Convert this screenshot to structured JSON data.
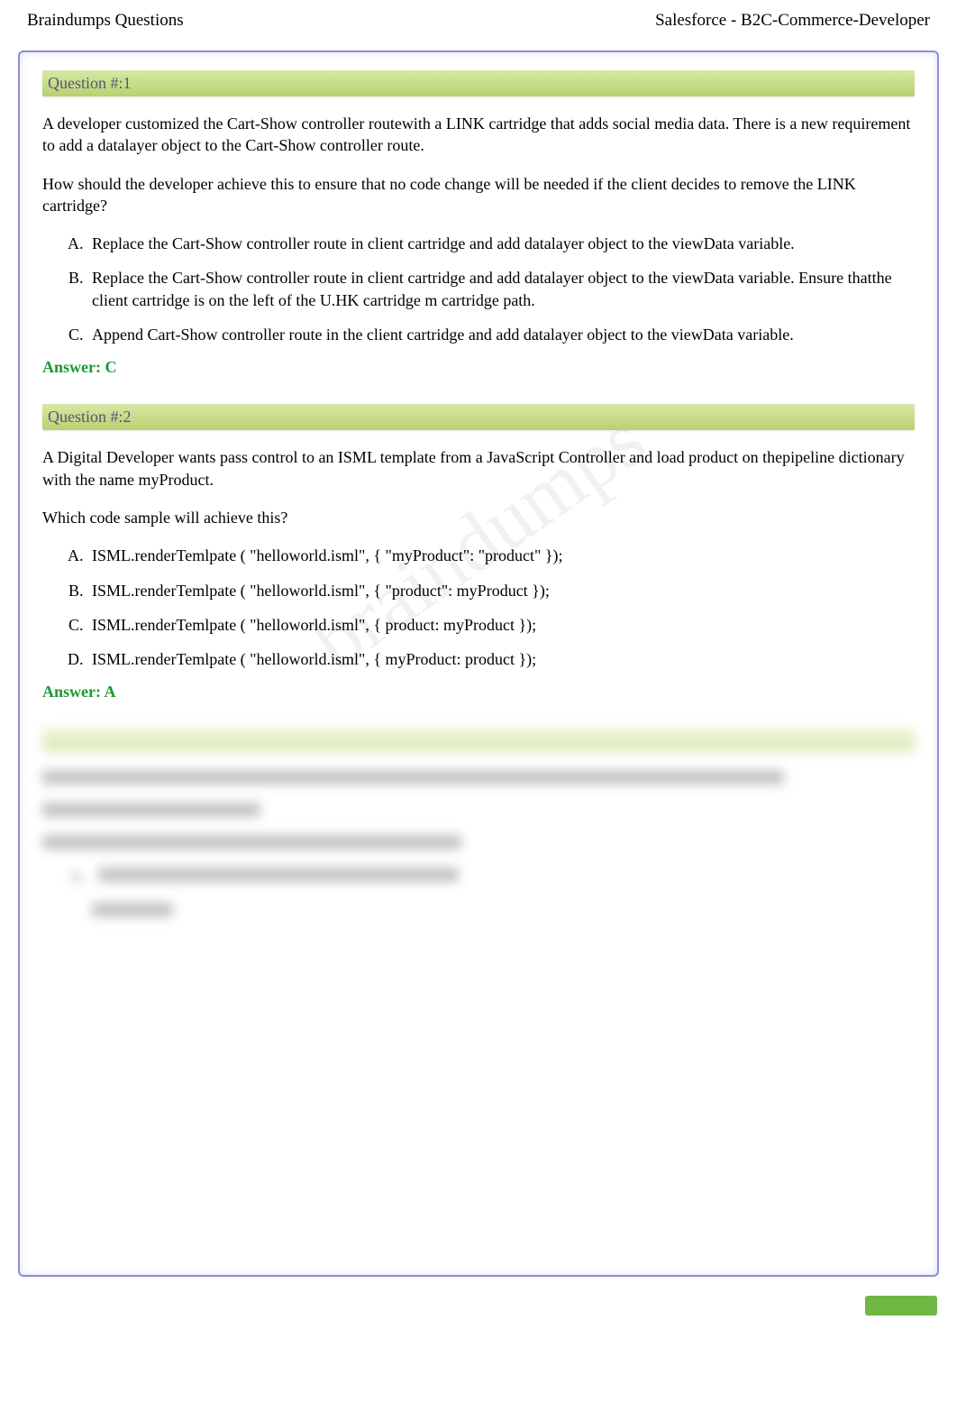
{
  "header": {
    "left": "Braindumps Questions",
    "right": "Salesforce - B2C-Commerce-Developer"
  },
  "questions": [
    {
      "label": "Question #:1",
      "paragraphs": [
        "A developer customized the Cart-Show controller routewith a LINK cartridge that adds social media data. There is a new requirement to add a datalayer object to the Cart-Show controller route.",
        "How should the developer achieve this to ensure that no code change will be needed if the client decides to remove the LINK cartridge?"
      ],
      "options": [
        "Replace the Cart-Show controller route in client cartridge and add datalayer object to the viewData variable.",
        "Replace the Cart-Show controller route in client cartridge and add datalayer object to the viewData variable. Ensure thatthe client cartridge is on the left of the U.HK cartridge m cartridge path.",
        "Append Cart-Show controller route in the client cartridge and add datalayer object to the viewData variable."
      ],
      "answer": "Answer: C"
    },
    {
      "label": "Question #:2",
      "paragraphs": [
        "A Digital Developer wants pass control to an ISML template from a JavaScript Controller and load product on thepipeline dictionary with the name myProduct.",
        "Which code sample will achieve this?"
      ],
      "options": [
        "ISML.renderTemlpate ( \"helloworld.isml\", { \"myProduct\": \"product\" });",
        "ISML.renderTemlpate ( \"helloworld.isml\", { \"product\": myProduct });",
        "ISML.renderTemlpate ( \"helloworld.isml\", { product: myProduct });",
        "ISML.renderTemlpate ( \"helloworld.isml\", { myProduct: product });"
      ],
      "answer": "Answer: A"
    }
  ],
  "blurred_option_letter": "A."
}
